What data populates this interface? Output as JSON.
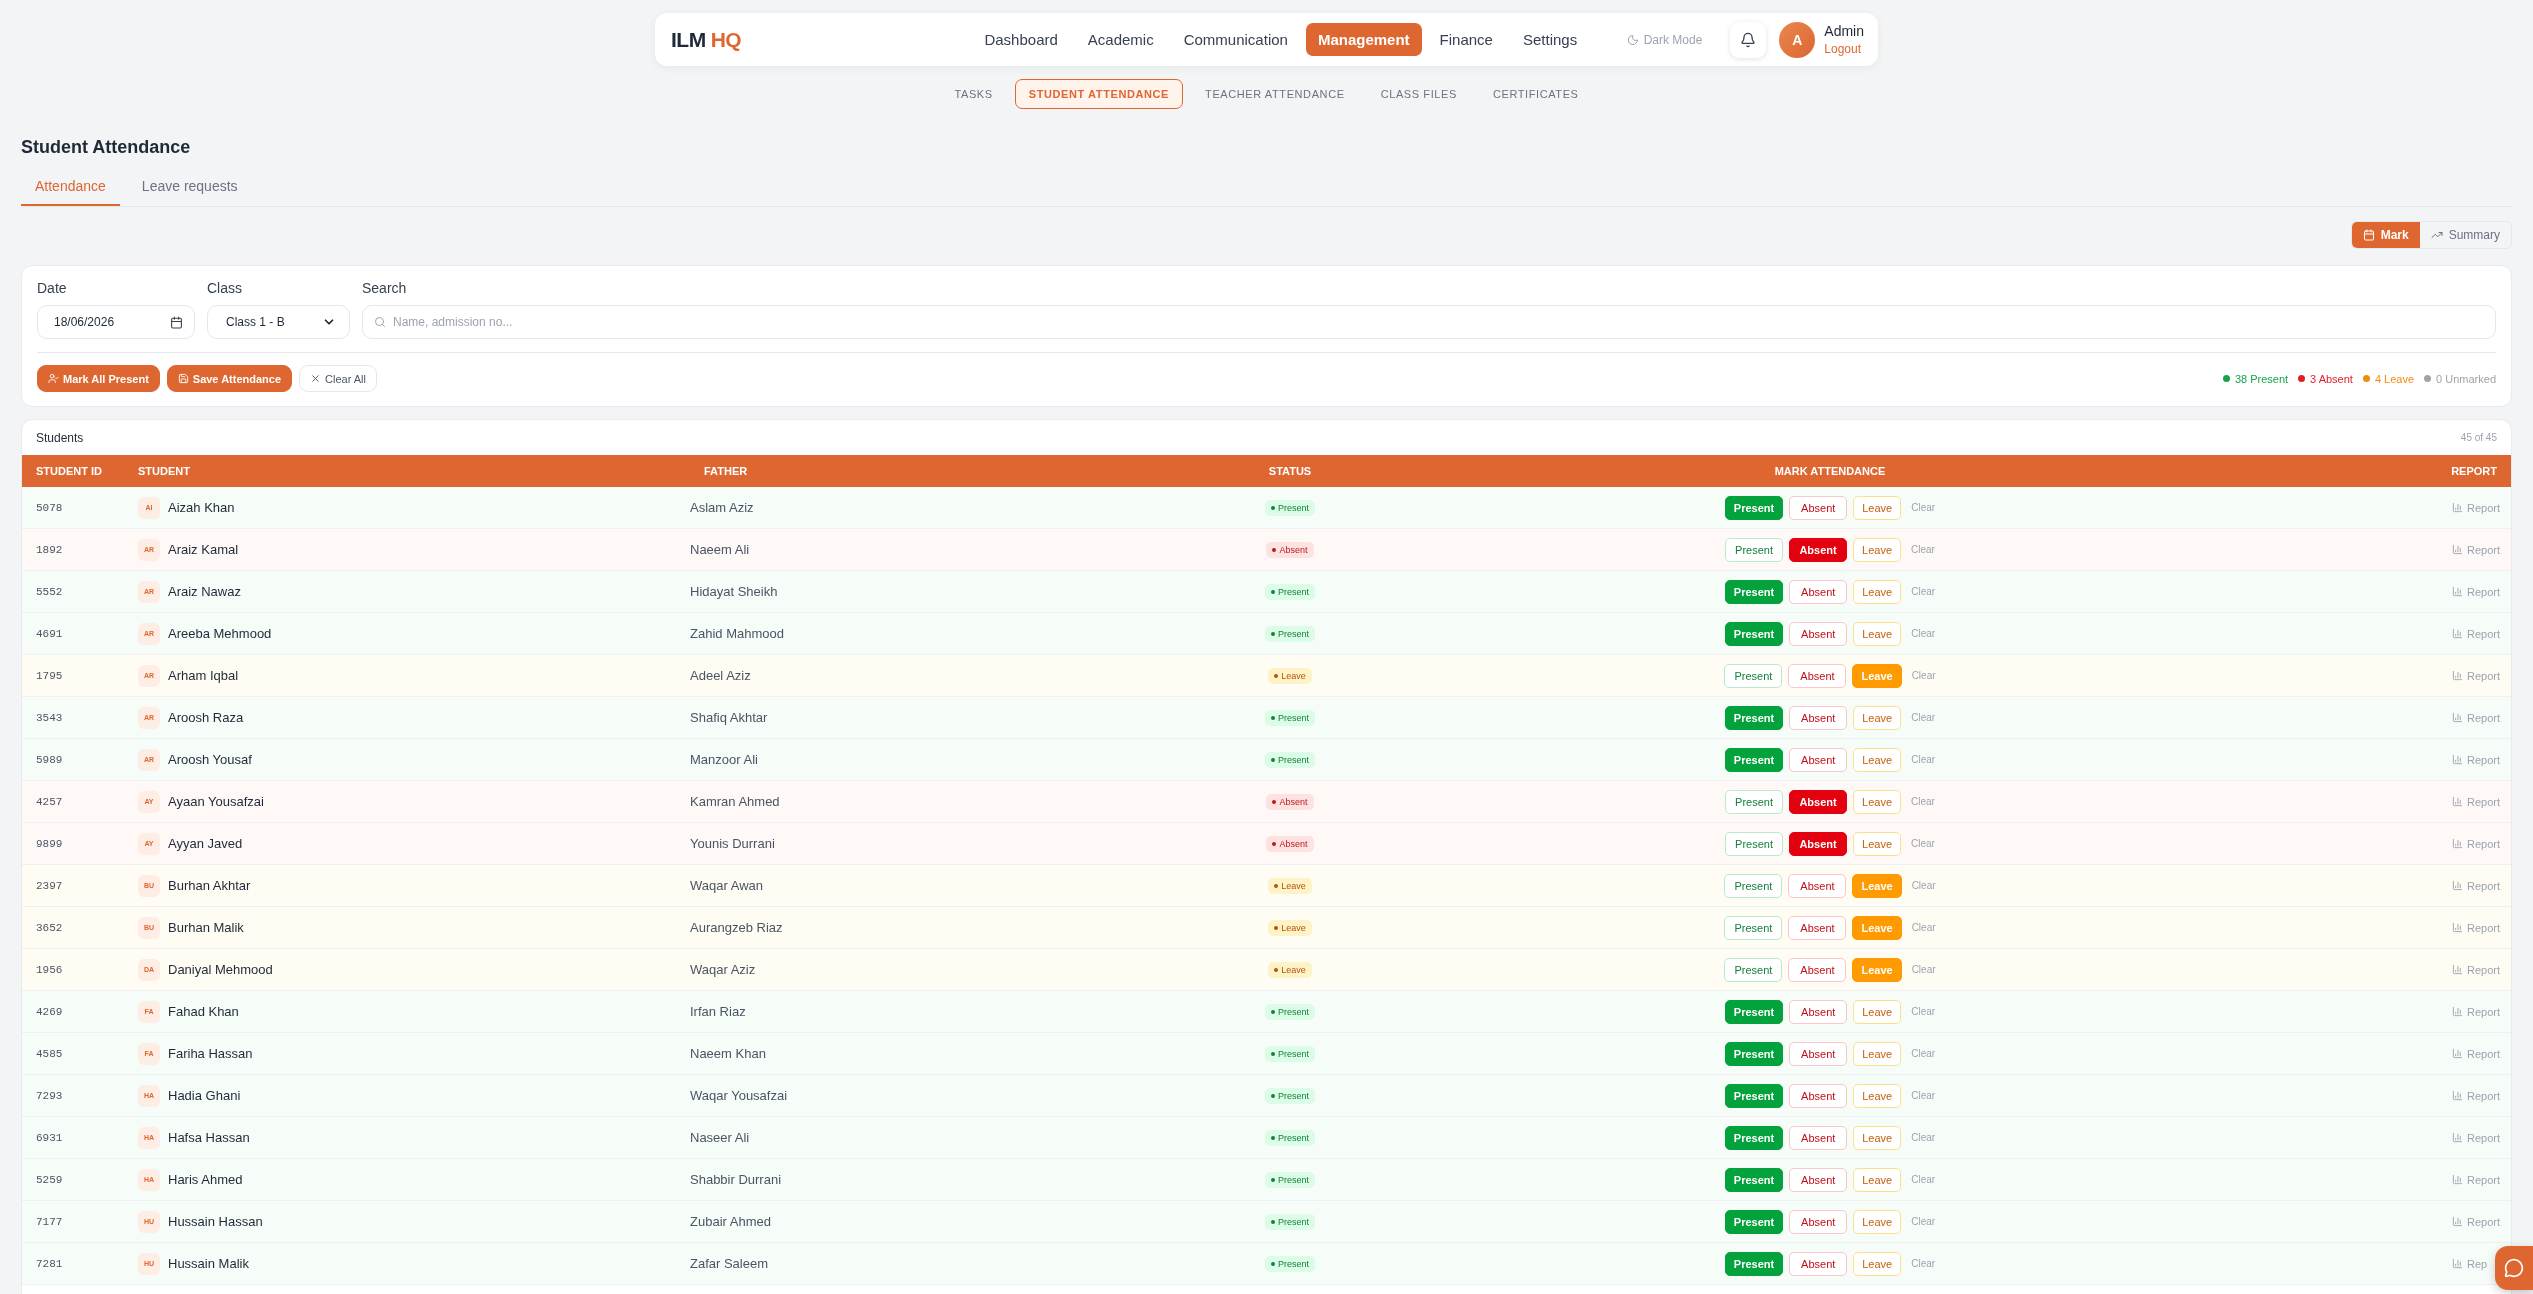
{
  "nav": {
    "logo": {
      "part1": "ILM",
      "part2": "HQ"
    },
    "menu": [
      {
        "label": "Dashboard",
        "selected": false
      },
      {
        "label": "Academic",
        "selected": false
      },
      {
        "label": "Communication",
        "selected": false
      },
      {
        "label": "Management",
        "selected": true
      },
      {
        "label": "Finance",
        "selected": false
      },
      {
        "label": "Settings",
        "selected": false
      }
    ],
    "dark_mode": "Dark Mode",
    "avatar": "A",
    "user": "Admin",
    "logout": "Logout"
  },
  "subnav": [
    {
      "label": "TASKS",
      "selected": false
    },
    {
      "label": "STUDENT ATTENDANCE",
      "selected": true
    },
    {
      "label": "TEACHER ATTENDANCE",
      "selected": false
    },
    {
      "label": "CLASS FILES",
      "selected": false
    },
    {
      "label": "CERTIFICATES",
      "selected": false
    }
  ],
  "title": "Student Attendance",
  "tabs": [
    {
      "label": "Attendance",
      "selected": true
    },
    {
      "label": "Leave requests",
      "selected": false
    }
  ],
  "view_toggle": [
    {
      "label": "Mark",
      "kind": "mark",
      "selected": true
    },
    {
      "label": "Summary",
      "kind": "summary",
      "selected": false
    }
  ],
  "filters": {
    "date": {
      "label": "Date",
      "value": "18/06/2026"
    },
    "class": {
      "label": "Class",
      "value": "Class 1 - B"
    },
    "search": {
      "label": "Search",
      "placeholder": "Name, admission no..."
    }
  },
  "actions": [
    {
      "label": "Mark All Present",
      "kind": "mark-all"
    },
    {
      "label": "Save Attendance",
      "kind": "save"
    },
    {
      "label": "Clear All",
      "kind": "clear"
    }
  ],
  "counts": [
    {
      "label": "38 Present",
      "color": "#16a34a"
    },
    {
      "label": "3 Absent",
      "color": "#e11d2a"
    },
    {
      "label": "4 Leave",
      "color": "#f28c0f"
    },
    {
      "label": "0 Unmarked",
      "color": "#a8a29e"
    }
  ],
  "table": {
    "title": "Students",
    "count": "45 of 45",
    "columns": [
      "STUDENT ID",
      "STUDENT",
      "FATHER",
      "STATUS",
      "MARK ATTENDANCE",
      "REPORT"
    ],
    "rows": [
      {
        "id": "5078",
        "initials": "AI",
        "name": "Aizah Khan",
        "father": "Aslam Aziz",
        "status": {
          "kind": "present",
          "label": "Present"
        },
        "marks": [
          {
            "kind": "present",
            "label": "Present",
            "selected": true
          },
          {
            "kind": "absent",
            "label": "Absent",
            "selected": false
          },
          {
            "kind": "leave",
            "label": "Leave",
            "selected": false
          }
        ],
        "clear": "Clear",
        "report": "Report"
      },
      {
        "id": "1892",
        "initials": "AR",
        "name": "Araiz Kamal",
        "father": "Naeem Ali",
        "status": {
          "kind": "absent",
          "label": "Absent"
        },
        "marks": [
          {
            "kind": "present",
            "label": "Present",
            "selected": false
          },
          {
            "kind": "absent",
            "label": "Absent",
            "selected": true
          },
          {
            "kind": "leave",
            "label": "Leave",
            "selected": false
          }
        ],
        "clear": "Clear",
        "report": "Report"
      },
      {
        "id": "5552",
        "initials": "AR",
        "name": "Araiz Nawaz",
        "father": "Hidayat Sheikh",
        "status": {
          "kind": "present",
          "label": "Present"
        },
        "marks": [
          {
            "kind": "present",
            "label": "Present",
            "selected": true
          },
          {
            "kind": "absent",
            "label": "Absent",
            "selected": false
          },
          {
            "kind": "leave",
            "label": "Leave",
            "selected": false
          }
        ],
        "clear": "Clear",
        "report": "Report"
      },
      {
        "id": "4691",
        "initials": "AR",
        "name": "Areeba Mehmood",
        "father": "Zahid Mahmood",
        "status": {
          "kind": "present",
          "label": "Present"
        },
        "marks": [
          {
            "kind": "present",
            "label": "Present",
            "selected": true
          },
          {
            "kind": "absent",
            "label": "Absent",
            "selected": false
          },
          {
            "kind": "leave",
            "label": "Leave",
            "selected": false
          }
        ],
        "clear": "Clear",
        "report": "Report"
      },
      {
        "id": "1795",
        "initials": "AR",
        "name": "Arham Iqbal",
        "father": "Adeel Aziz",
        "status": {
          "kind": "leave",
          "label": "Leave"
        },
        "marks": [
          {
            "kind": "present",
            "label": "Present",
            "selected": false
          },
          {
            "kind": "absent",
            "label": "Absent",
            "selected": false
          },
          {
            "kind": "leave",
            "label": "Leave",
            "selected": true
          }
        ],
        "clear": "Clear",
        "report": "Report"
      },
      {
        "id": "3543",
        "initials": "AR",
        "name": "Aroosh Raza",
        "father": "Shafiq Akhtar",
        "status": {
          "kind": "present",
          "label": "Present"
        },
        "marks": [
          {
            "kind": "present",
            "label": "Present",
            "selected": true
          },
          {
            "kind": "absent",
            "label": "Absent",
            "selected": false
          },
          {
            "kind": "leave",
            "label": "Leave",
            "selected": false
          }
        ],
        "clear": "Clear",
        "report": "Report"
      },
      {
        "id": "5989",
        "initials": "AR",
        "name": "Aroosh Yousaf",
        "father": "Manzoor Ali",
        "status": {
          "kind": "present",
          "label": "Present"
        },
        "marks": [
          {
            "kind": "present",
            "label": "Present",
            "selected": true
          },
          {
            "kind": "absent",
            "label": "Absent",
            "selected": false
          },
          {
            "kind": "leave",
            "label": "Leave",
            "selected": false
          }
        ],
        "clear": "Clear",
        "report": "Report"
      },
      {
        "id": "4257",
        "initials": "AY",
        "name": "Ayaan Yousafzai",
        "father": "Kamran Ahmed",
        "status": {
          "kind": "absent",
          "label": "Absent"
        },
        "marks": [
          {
            "kind": "present",
            "label": "Present",
            "selected": false
          },
          {
            "kind": "absent",
            "label": "Absent",
            "selected": true
          },
          {
            "kind": "leave",
            "label": "Leave",
            "selected": false
          }
        ],
        "clear": "Clear",
        "report": "Report"
      },
      {
        "id": "9899",
        "initials": "AY",
        "name": "Ayyan Javed",
        "father": "Younis Durrani",
        "status": {
          "kind": "absent",
          "label": "Absent"
        },
        "marks": [
          {
            "kind": "present",
            "label": "Present",
            "selected": false
          },
          {
            "kind": "absent",
            "label": "Absent",
            "selected": true
          },
          {
            "kind": "leave",
            "label": "Leave",
            "selected": false
          }
        ],
        "clear": "Clear",
        "report": "Report"
      },
      {
        "id": "2397",
        "initials": "BU",
        "name": "Burhan Akhtar",
        "father": "Waqar Awan",
        "status": {
          "kind": "leave",
          "label": "Leave"
        },
        "marks": [
          {
            "kind": "present",
            "label": "Present",
            "selected": false
          },
          {
            "kind": "absent",
            "label": "Absent",
            "selected": false
          },
          {
            "kind": "leave",
            "label": "Leave",
            "selected": true
          }
        ],
        "clear": "Clear",
        "report": "Report"
      },
      {
        "id": "3652",
        "initials": "BU",
        "name": "Burhan Malik",
        "father": "Aurangzeb Riaz",
        "status": {
          "kind": "leave",
          "label": "Leave"
        },
        "marks": [
          {
            "kind": "present",
            "label": "Present",
            "selected": false
          },
          {
            "kind": "absent",
            "label": "Absent",
            "selected": false
          },
          {
            "kind": "leave",
            "label": "Leave",
            "selected": true
          }
        ],
        "clear": "Clear",
        "report": "Report"
      },
      {
        "id": "1956",
        "initials": "DA",
        "name": "Daniyal Mehmood",
        "father": "Waqar Aziz",
        "status": {
          "kind": "leave",
          "label": "Leave"
        },
        "marks": [
          {
            "kind": "present",
            "label": "Present",
            "selected": false
          },
          {
            "kind": "absent",
            "label": "Absent",
            "selected": false
          },
          {
            "kind": "leave",
            "label": "Leave",
            "selected": true
          }
        ],
        "clear": "Clear",
        "report": "Report"
      },
      {
        "id": "4269",
        "initials": "FA",
        "name": "Fahad Khan",
        "father": "Irfan Riaz",
        "status": {
          "kind": "present",
          "label": "Present"
        },
        "marks": [
          {
            "kind": "present",
            "label": "Present",
            "selected": true
          },
          {
            "kind": "absent",
            "label": "Absent",
            "selected": false
          },
          {
            "kind": "leave",
            "label": "Leave",
            "selected": false
          }
        ],
        "clear": "Clear",
        "report": "Report"
      },
      {
        "id": "4585",
        "initials": "FA",
        "name": "Fariha Hassan",
        "father": "Naeem Khan",
        "status": {
          "kind": "present",
          "label": "Present"
        },
        "marks": [
          {
            "kind": "present",
            "label": "Present",
            "selected": true
          },
          {
            "kind": "absent",
            "label": "Absent",
            "selected": false
          },
          {
            "kind": "leave",
            "label": "Leave",
            "selected": false
          }
        ],
        "clear": "Clear",
        "report": "Report"
      },
      {
        "id": "7293",
        "initials": "HA",
        "name": "Hadia Ghani",
        "father": "Waqar Yousafzai",
        "status": {
          "kind": "present",
          "label": "Present"
        },
        "marks": [
          {
            "kind": "present",
            "label": "Present",
            "selected": true
          },
          {
            "kind": "absent",
            "label": "Absent",
            "selected": false
          },
          {
            "kind": "leave",
            "label": "Leave",
            "selected": false
          }
        ],
        "clear": "Clear",
        "report": "Report"
      },
      {
        "id": "6931",
        "initials": "HA",
        "name": "Hafsa Hassan",
        "father": "Naseer Ali",
        "status": {
          "kind": "present",
          "label": "Present"
        },
        "marks": [
          {
            "kind": "present",
            "label": "Present",
            "selected": true
          },
          {
            "kind": "absent",
            "label": "Absent",
            "selected": false
          },
          {
            "kind": "leave",
            "label": "Leave",
            "selected": false
          }
        ],
        "clear": "Clear",
        "report": "Report"
      },
      {
        "id": "5259",
        "initials": "HA",
        "name": "Haris Ahmed",
        "father": "Shabbir Durrani",
        "status": {
          "kind": "present",
          "label": "Present"
        },
        "marks": [
          {
            "kind": "present",
            "label": "Present",
            "selected": true
          },
          {
            "kind": "absent",
            "label": "Absent",
            "selected": false
          },
          {
            "kind": "leave",
            "label": "Leave",
            "selected": false
          }
        ],
        "clear": "Clear",
        "report": "Report"
      },
      {
        "id": "7177",
        "initials": "HU",
        "name": "Hussain Hassan",
        "father": "Zubair Ahmed",
        "status": {
          "kind": "present",
          "label": "Present"
        },
        "marks": [
          {
            "kind": "present",
            "label": "Present",
            "selected": true
          },
          {
            "kind": "absent",
            "label": "Absent",
            "selected": false
          },
          {
            "kind": "leave",
            "label": "Leave",
            "selected": false
          }
        ],
        "clear": "Clear",
        "report": "Report"
      },
      {
        "id": "7281",
        "initials": "HU",
        "name": "Hussain Malik",
        "father": "Zafar Saleem",
        "status": {
          "kind": "present",
          "label": "Present"
        },
        "marks": [
          {
            "kind": "present",
            "label": "Present",
            "selected": true
          },
          {
            "kind": "absent",
            "label": "Absent",
            "selected": false
          },
          {
            "kind": "leave",
            "label": "Leave",
            "selected": false
          }
        ],
        "clear": "Clear",
        "report": "Rep"
      }
    ]
  }
}
